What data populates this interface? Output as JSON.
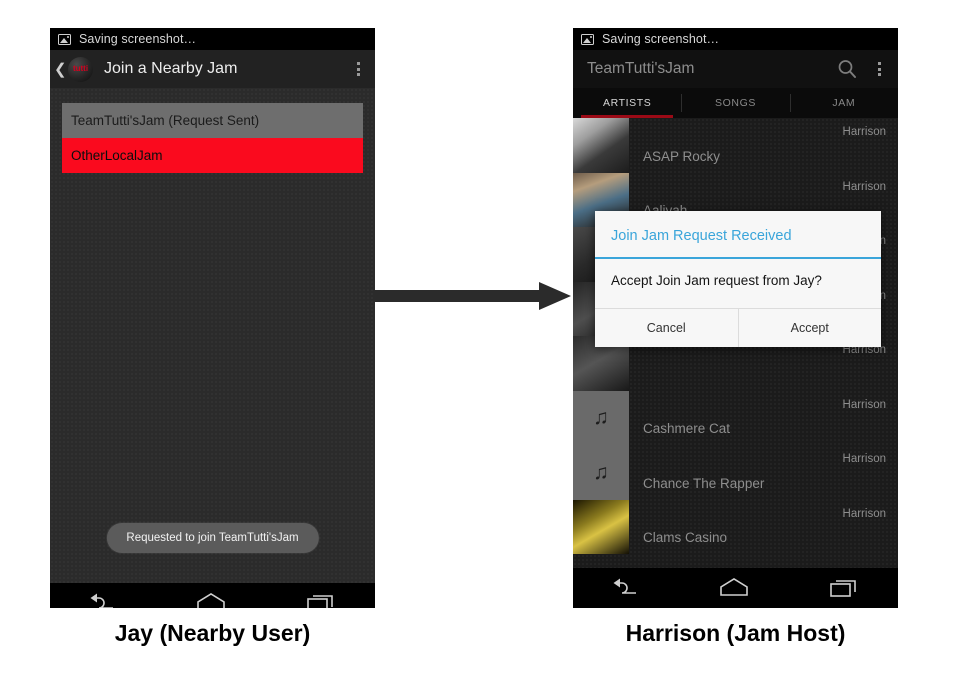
{
  "left_phone": {
    "status_bar": {
      "icon": "image-icon",
      "text": "Saving screenshot…"
    },
    "action_bar": {
      "up_icon": "back-chevron-icon",
      "logo_text": "tutti",
      "title": "Join a Nearby Jam",
      "overflow_icon": "overflow-menu-icon"
    },
    "jam_list": [
      {
        "label": "TeamTutti'sJam (Request Sent)",
        "state": "normal"
      },
      {
        "label": "OtherLocalJam",
        "state": "selected"
      }
    ],
    "toast": "Requested to join TeamTutti'sJam",
    "nav": {
      "back": "back-icon",
      "home": "home-icon",
      "recents": "recents-icon"
    }
  },
  "right_phone": {
    "status_bar": {
      "icon": "image-icon",
      "text": "Saving screenshot…"
    },
    "action_bar": {
      "title": "TeamTutti'sJam",
      "search_icon": "search-icon",
      "overflow_icon": "overflow-menu-icon"
    },
    "tabs": [
      {
        "label": "ARTISTS",
        "active": true
      },
      {
        "label": "SONGS",
        "active": false
      },
      {
        "label": "JAM",
        "active": false
      }
    ],
    "artists": [
      {
        "name": "ASAP Rocky",
        "owner": "Harrison",
        "art": "art1"
      },
      {
        "name": "Aaliyah",
        "owner": "Harrison",
        "art": "art2"
      },
      {
        "name": "",
        "owner": "Harrison",
        "art": "art3"
      },
      {
        "name": "",
        "owner": "Harrison",
        "art": "art4"
      },
      {
        "name": "",
        "owner": "Harrison",
        "art": "art5"
      },
      {
        "name": "Cashmere Cat",
        "owner": "Harrison",
        "art": "note"
      },
      {
        "name": "Chance The Rapper",
        "owner": "Harrison",
        "art": "note"
      },
      {
        "name": "Clams Casino",
        "owner": "Harrison",
        "art": "art6"
      }
    ],
    "dialog": {
      "title": "Join Jam Request Received",
      "message": "Accept Join Jam request from Jay?",
      "cancel": "Cancel",
      "accept": "Accept"
    },
    "nav": {
      "back": "back-icon",
      "home": "home-icon",
      "recents": "recents-icon"
    }
  },
  "captions": {
    "left": "Jay (Nearby User)",
    "right": "Harrison (Jam Host)"
  },
  "colors": {
    "selected_red": "#fa0a1e",
    "tab_indicator": "#9b0a16",
    "dialog_accent": "#3aa5da"
  }
}
